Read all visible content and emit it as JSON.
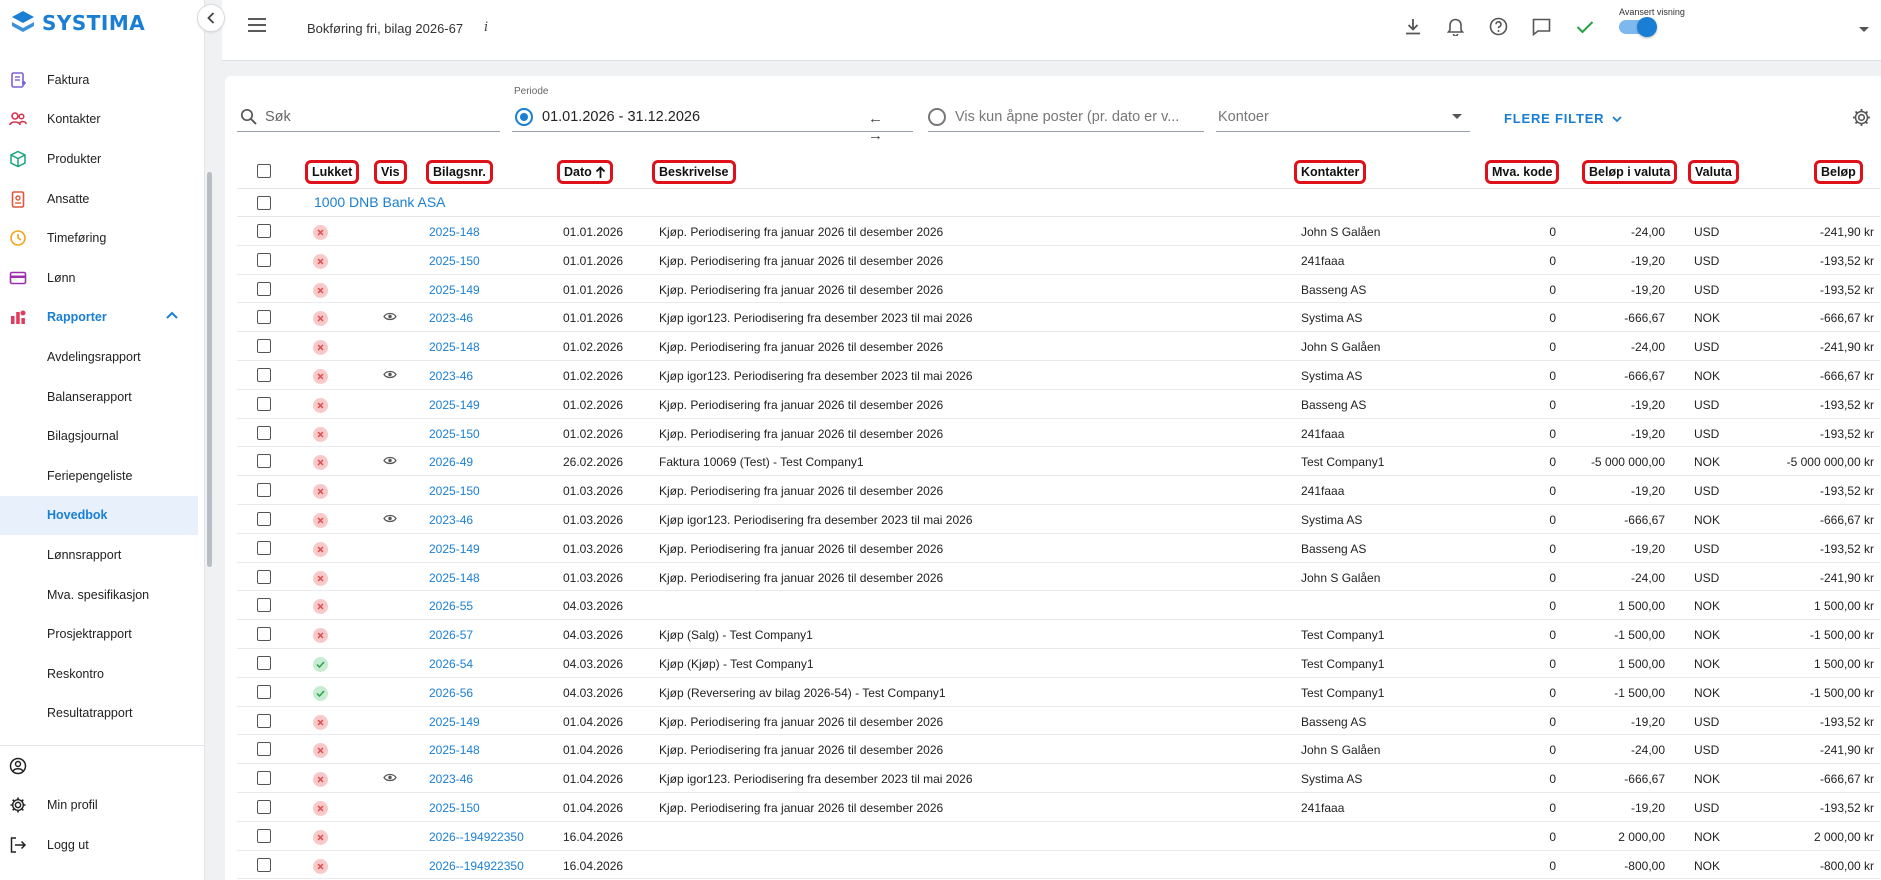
{
  "brand": {
    "name": "SYSTIMA",
    "color": "#1a7fd4"
  },
  "sidebar": {
    "items": [
      {
        "label": "Faktura",
        "icon": "invoice-icon",
        "color": "#7b61d6"
      },
      {
        "label": "Kontakter",
        "icon": "contacts-icon",
        "color": "#d1344e"
      },
      {
        "label": "Produkter",
        "icon": "box-icon",
        "color": "#1aa37a"
      },
      {
        "label": "Ansatte",
        "icon": "badge-icon",
        "color": "#e0573b"
      },
      {
        "label": "Timeføring",
        "icon": "clock-icon",
        "color": "#f2a516"
      },
      {
        "label": "Lønn",
        "icon": "card-icon",
        "color": "#9b2fae"
      },
      {
        "label": "Rapporter",
        "icon": "reports-icon",
        "color": "#e03b5c"
      }
    ],
    "report_items": [
      "Avdelingsrapport",
      "Balanserapport",
      "Bilagsjournal",
      "Feriepengeliste",
      "Hovedbok",
      "Lønnsrapport",
      "Mva. spesifikasjon",
      "Prosjektrapport",
      "Reskontro",
      "Resultatrapport"
    ],
    "active_report": "Hovedbok",
    "bottom": {
      "profile": "Min profil",
      "logout": "Logg ut"
    }
  },
  "topbar": {
    "title": "Bokføring fri, bilag 2026-67",
    "info": "i",
    "advanced_label": "Avansert visning",
    "advanced_on": true
  },
  "filters": {
    "search_placeholder": "Søk",
    "periode_label": "Periode",
    "periode_value": "01.01.2026 - 31.12.2026",
    "arrows": "← →",
    "open_posts": "Vis kun åpne poster (pr. dato er v...",
    "kontoer": "Kontoer",
    "more_filters": "FLERE FILTER"
  },
  "columns": {
    "lukket": "Lukket",
    "vis": "Vis",
    "bilagsnr": "Bilagsnr.",
    "dato": "Dato",
    "beskrivelse": "Beskrivelse",
    "kontakter": "Kontakter",
    "mva": "Mva. kode",
    "belop_valuta": "Beløp i valuta",
    "valuta": "Valuta",
    "belop": "Beløp"
  },
  "group": "1000 DNB Bank ASA",
  "rows": [
    {
      "closed": false,
      "vis": false,
      "bilag": "2025-148",
      "dato": "01.01.2026",
      "besk": "Kjøp. Periodisering fra januar 2026 til desember 2026",
      "kontakt": "John S Galåen",
      "mva": "0",
      "belv": "-24,00",
      "val": "USD",
      "bel": "-241,90 kr"
    },
    {
      "closed": false,
      "vis": false,
      "bilag": "2025-150",
      "dato": "01.01.2026",
      "besk": "Kjøp. Periodisering fra januar 2026 til desember 2026",
      "kontakt": "241faaa",
      "mva": "0",
      "belv": "-19,20",
      "val": "USD",
      "bel": "-193,52 kr"
    },
    {
      "closed": false,
      "vis": false,
      "bilag": "2025-149",
      "dato": "01.01.2026",
      "besk": "Kjøp. Periodisering fra januar 2026 til desember 2026",
      "kontakt": "Basseng AS",
      "mva": "0",
      "belv": "-19,20",
      "val": "USD",
      "bel": "-193,52 kr"
    },
    {
      "closed": false,
      "vis": true,
      "bilag": "2023-46",
      "dato": "01.01.2026",
      "besk": "Kjøp igor123. Periodisering fra desember 2023 til mai 2026",
      "kontakt": "Systima AS",
      "mva": "0",
      "belv": "-666,67",
      "val": "NOK",
      "bel": "-666,67 kr"
    },
    {
      "closed": false,
      "vis": false,
      "bilag": "2025-148",
      "dato": "01.02.2026",
      "besk": "Kjøp. Periodisering fra januar 2026 til desember 2026",
      "kontakt": "John S Galåen",
      "mva": "0",
      "belv": "-24,00",
      "val": "USD",
      "bel": "-241,90 kr"
    },
    {
      "closed": false,
      "vis": true,
      "bilag": "2023-46",
      "dato": "01.02.2026",
      "besk": "Kjøp igor123. Periodisering fra desember 2023 til mai 2026",
      "kontakt": "Systima AS",
      "mva": "0",
      "belv": "-666,67",
      "val": "NOK",
      "bel": "-666,67 kr"
    },
    {
      "closed": false,
      "vis": false,
      "bilag": "2025-149",
      "dato": "01.02.2026",
      "besk": "Kjøp. Periodisering fra januar 2026 til desember 2026",
      "kontakt": "Basseng AS",
      "mva": "0",
      "belv": "-19,20",
      "val": "USD",
      "bel": "-193,52 kr"
    },
    {
      "closed": false,
      "vis": false,
      "bilag": "2025-150",
      "dato": "01.02.2026",
      "besk": "Kjøp. Periodisering fra januar 2026 til desember 2026",
      "kontakt": "241faaa",
      "mva": "0",
      "belv": "-19,20",
      "val": "USD",
      "bel": "-193,52 kr"
    },
    {
      "closed": false,
      "vis": true,
      "bilag": "2026-49",
      "dato": "26.02.2026",
      "besk": "Faktura 10069 (Test) - Test Company1",
      "kontakt": "Test Company1",
      "mva": "0",
      "belv": "-5 000 000,00",
      "val": "NOK",
      "bel": "-5 000 000,00 kr"
    },
    {
      "closed": false,
      "vis": false,
      "bilag": "2025-150",
      "dato": "01.03.2026",
      "besk": "Kjøp. Periodisering fra januar 2026 til desember 2026",
      "kontakt": "241faaa",
      "mva": "0",
      "belv": "-19,20",
      "val": "USD",
      "bel": "-193,52 kr"
    },
    {
      "closed": false,
      "vis": true,
      "bilag": "2023-46",
      "dato": "01.03.2026",
      "besk": "Kjøp igor123. Periodisering fra desember 2023 til mai 2026",
      "kontakt": "Systima AS",
      "mva": "0",
      "belv": "-666,67",
      "val": "NOK",
      "bel": "-666,67 kr"
    },
    {
      "closed": false,
      "vis": false,
      "bilag": "2025-149",
      "dato": "01.03.2026",
      "besk": "Kjøp. Periodisering fra januar 2026 til desember 2026",
      "kontakt": "Basseng AS",
      "mva": "0",
      "belv": "-19,20",
      "val": "USD",
      "bel": "-193,52 kr"
    },
    {
      "closed": false,
      "vis": false,
      "bilag": "2025-148",
      "dato": "01.03.2026",
      "besk": "Kjøp. Periodisering fra januar 2026 til desember 2026",
      "kontakt": "John S Galåen",
      "mva": "0",
      "belv": "-24,00",
      "val": "USD",
      "bel": "-241,90 kr"
    },
    {
      "closed": false,
      "vis": false,
      "bilag": "2026-55",
      "dato": "04.03.2026",
      "besk": "",
      "kontakt": "",
      "mva": "0",
      "belv": "1 500,00",
      "val": "NOK",
      "bel": "1 500,00 kr"
    },
    {
      "closed": false,
      "vis": false,
      "bilag": "2026-57",
      "dato": "04.03.2026",
      "besk": "Kjøp (Salg) - Test Company1",
      "kontakt": "Test Company1",
      "mva": "0",
      "belv": "-1 500,00",
      "val": "NOK",
      "bel": "-1 500,00 kr"
    },
    {
      "closed": true,
      "vis": false,
      "bilag": "2026-54",
      "dato": "04.03.2026",
      "besk": "Kjøp (Kjøp) - Test Company1",
      "kontakt": "Test Company1",
      "mva": "0",
      "belv": "1 500,00",
      "val": "NOK",
      "bel": "1 500,00 kr"
    },
    {
      "closed": true,
      "vis": false,
      "bilag": "2026-56",
      "dato": "04.03.2026",
      "besk": "Kjøp (Reversering av bilag 2026-54) - Test Company1",
      "kontakt": "Test Company1",
      "mva": "0",
      "belv": "-1 500,00",
      "val": "NOK",
      "bel": "-1 500,00 kr"
    },
    {
      "closed": false,
      "vis": false,
      "bilag": "2025-149",
      "dato": "01.04.2026",
      "besk": "Kjøp. Periodisering fra januar 2026 til desember 2026",
      "kontakt": "Basseng AS",
      "mva": "0",
      "belv": "-19,20",
      "val": "USD",
      "bel": "-193,52 kr"
    },
    {
      "closed": false,
      "vis": false,
      "bilag": "2025-148",
      "dato": "01.04.2026",
      "besk": "Kjøp. Periodisering fra januar 2026 til desember 2026",
      "kontakt": "John S Galåen",
      "mva": "0",
      "belv": "-24,00",
      "val": "USD",
      "bel": "-241,90 kr"
    },
    {
      "closed": false,
      "vis": true,
      "bilag": "2023-46",
      "dato": "01.04.2026",
      "besk": "Kjøp igor123. Periodisering fra desember 2023 til mai 2026",
      "kontakt": "Systima AS",
      "mva": "0",
      "belv": "-666,67",
      "val": "NOK",
      "bel": "-666,67 kr"
    },
    {
      "closed": false,
      "vis": false,
      "bilag": "2025-150",
      "dato": "01.04.2026",
      "besk": "Kjøp. Periodisering fra januar 2026 til desember 2026",
      "kontakt": "241faaa",
      "mva": "0",
      "belv": "-19,20",
      "val": "USD",
      "bel": "-193,52 kr"
    },
    {
      "closed": false,
      "vis": false,
      "bilag": "2026--194922350",
      "dato": "16.04.2026",
      "besk": "",
      "kontakt": "",
      "mva": "0",
      "belv": "2 000,00",
      "val": "NOK",
      "bel": "2 000,00 kr"
    },
    {
      "closed": false,
      "vis": false,
      "bilag": "2026--194922350",
      "dato": "16.04.2026",
      "besk": "",
      "kontakt": "",
      "mva": "0",
      "belv": "-800,00",
      "val": "NOK",
      "bel": "-800,00 kr"
    }
  ]
}
